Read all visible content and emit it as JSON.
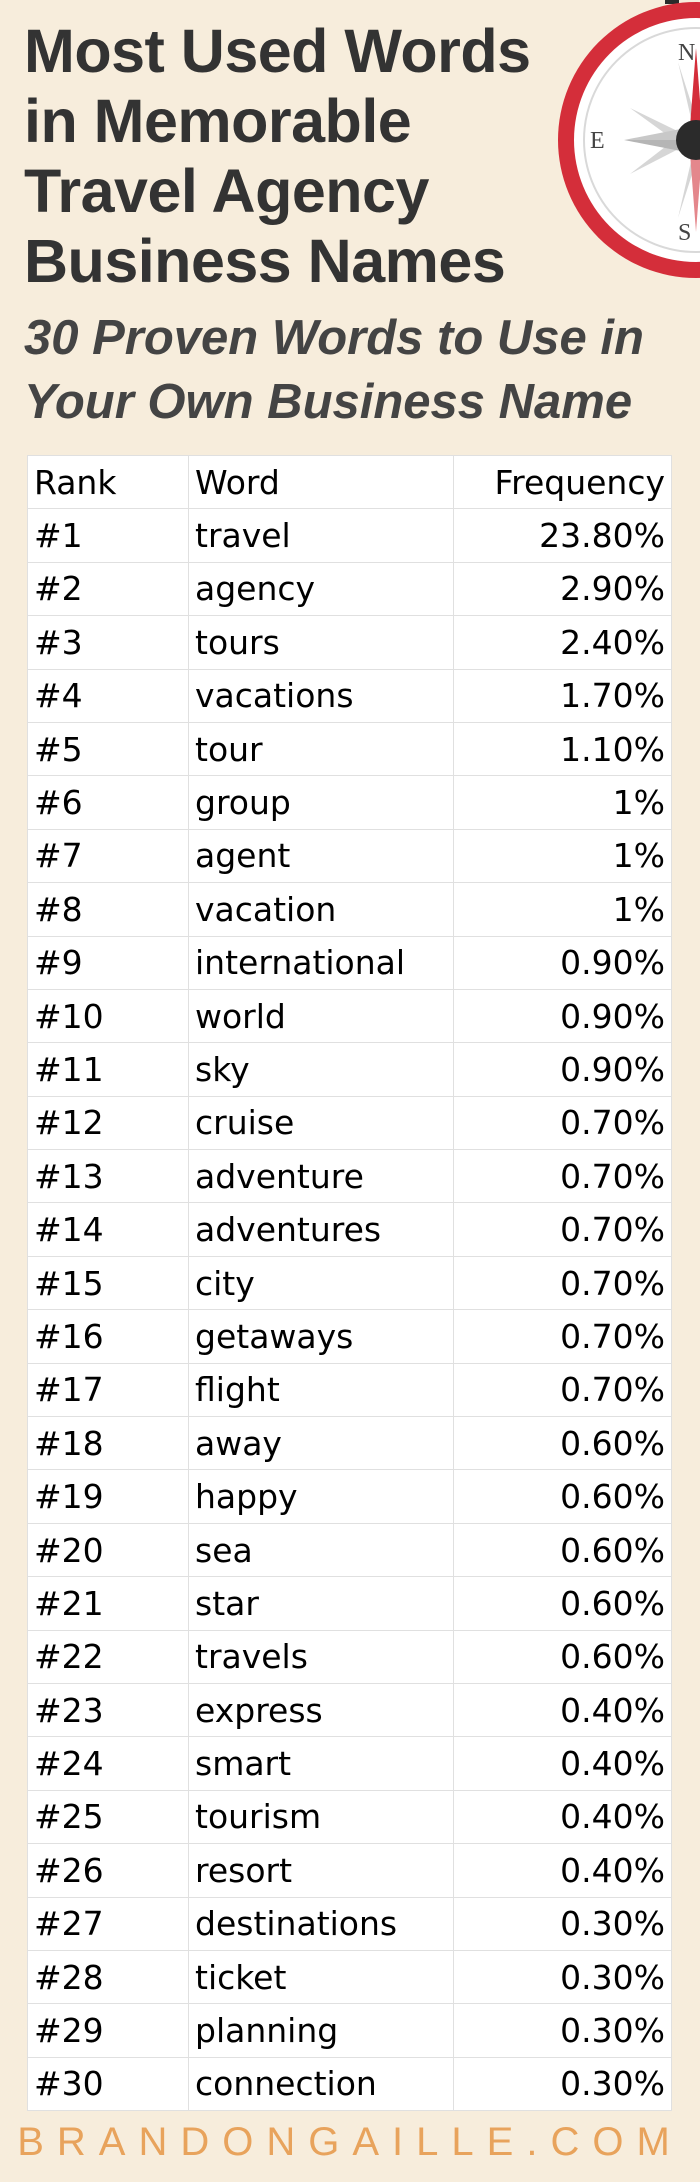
{
  "header": {
    "title_lines": [
      "Most Used Words",
      "in Memorable",
      "Travel Agency",
      "Business Names"
    ],
    "subtitle_lines": [
      "30 Proven Words to Use in",
      "Your Own Business Name"
    ]
  },
  "compass": {
    "north": "N",
    "east": "E",
    "south": "S",
    "ring_color": "#d42e3a"
  },
  "table": {
    "headers": {
      "rank": "Rank",
      "word": "Word",
      "frequency": "Frequency"
    },
    "rows": [
      {
        "rank": "#1",
        "word": "travel",
        "frequency": "23.80%"
      },
      {
        "rank": "#2",
        "word": "agency",
        "frequency": "2.90%"
      },
      {
        "rank": "#3",
        "word": "tours",
        "frequency": "2.40%"
      },
      {
        "rank": "#4",
        "word": "vacations",
        "frequency": "1.70%"
      },
      {
        "rank": "#5",
        "word": "tour",
        "frequency": "1.10%"
      },
      {
        "rank": "#6",
        "word": "group",
        "frequency": "1%"
      },
      {
        "rank": "#7",
        "word": "agent",
        "frequency": "1%"
      },
      {
        "rank": "#8",
        "word": "vacation",
        "frequency": "1%"
      },
      {
        "rank": "#9",
        "word": "international",
        "frequency": "0.90%"
      },
      {
        "rank": "#10",
        "word": "world",
        "frequency": "0.90%"
      },
      {
        "rank": "#11",
        "word": "sky",
        "frequency": "0.90%"
      },
      {
        "rank": "#12",
        "word": "cruise",
        "frequency": "0.70%"
      },
      {
        "rank": "#13",
        "word": "adventure",
        "frequency": "0.70%"
      },
      {
        "rank": "#14",
        "word": "adventures",
        "frequency": "0.70%"
      },
      {
        "rank": "#15",
        "word": "city",
        "frequency": "0.70%"
      },
      {
        "rank": "#16",
        "word": "getaways",
        "frequency": "0.70%"
      },
      {
        "rank": "#17",
        "word": "flight",
        "frequency": "0.70%"
      },
      {
        "rank": "#18",
        "word": "away",
        "frequency": "0.60%"
      },
      {
        "rank": "#19",
        "word": "happy",
        "frequency": "0.60%"
      },
      {
        "rank": "#20",
        "word": "sea",
        "frequency": "0.60%"
      },
      {
        "rank": "#21",
        "word": "star",
        "frequency": "0.60%"
      },
      {
        "rank": "#22",
        "word": "travels",
        "frequency": "0.60%"
      },
      {
        "rank": "#23",
        "word": "express",
        "frequency": "0.40%"
      },
      {
        "rank": "#24",
        "word": "smart",
        "frequency": "0.40%"
      },
      {
        "rank": "#25",
        "word": "tourism",
        "frequency": "0.40%"
      },
      {
        "rank": "#26",
        "word": "resort",
        "frequency": "0.40%"
      },
      {
        "rank": "#27",
        "word": "destinations",
        "frequency": "0.30%"
      },
      {
        "rank": "#28",
        "word": "ticket",
        "frequency": "0.30%"
      },
      {
        "rank": "#29",
        "word": "planning",
        "frequency": "0.30%"
      },
      {
        "rank": "#30",
        "word": "connection",
        "frequency": "0.30%"
      }
    ]
  },
  "footer": {
    "text": "BRANDONGAILLE.COM",
    "color": "#e8a35c"
  }
}
